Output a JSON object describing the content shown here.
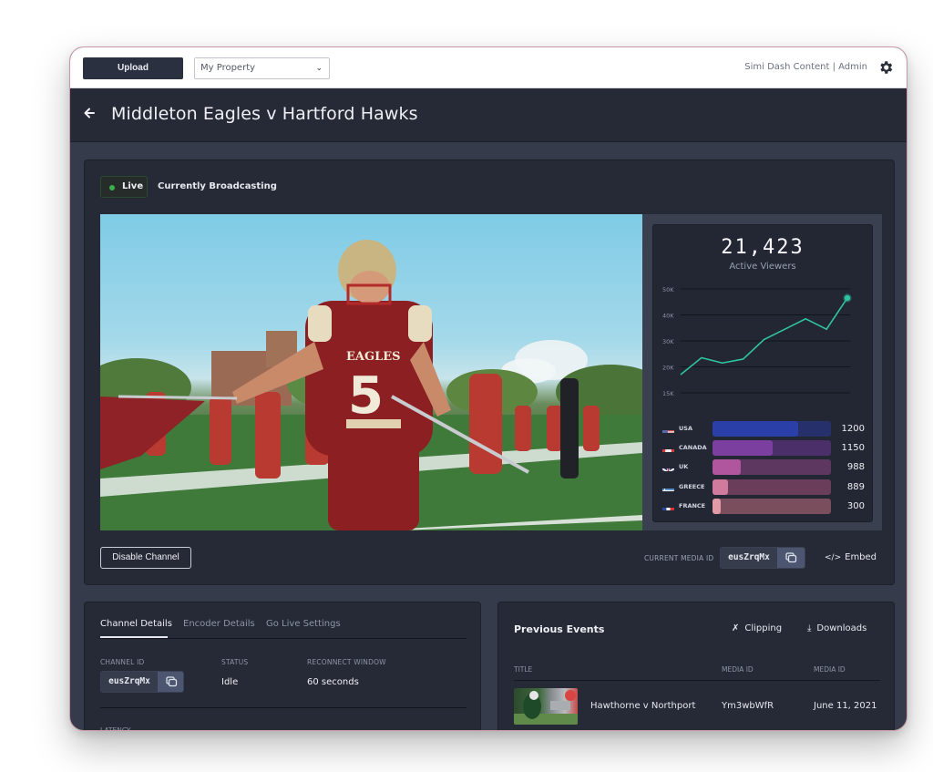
{
  "topbar": {
    "upload_label": "Upload",
    "property_select": {
      "value": "My Property"
    },
    "account_label": "Simi Dash Content | Admin",
    "settings_icon": "gear-icon"
  },
  "header": {
    "back_icon": "arrow-left-icon",
    "title": "Middleton Eagles v Hartford Hawks"
  },
  "broadcast": {
    "live_label": "Live",
    "status_text": "Currently Broadcasting",
    "live_color": "#3db04a"
  },
  "video": {
    "description": "Football player in red Eagles #5 jersey leading team onto field"
  },
  "stats": {
    "viewer_count": "21,423",
    "viewer_label": "Active Viewers",
    "line_color": "#2ec4a0",
    "countries": [
      {
        "flag": "us-flag-icon",
        "name": "USA",
        "value": "1200",
        "fill": 0.72,
        "color": "#2b3fa8",
        "track": "#26306a"
      },
      {
        "flag": "ca-flag-icon",
        "name": "CANADA",
        "value": "1150",
        "fill": 0.51,
        "color": "#7b3fa0",
        "track": "#4a2f68"
      },
      {
        "flag": "uk-flag-icon",
        "name": "UK",
        "value": "988",
        "fill": 0.24,
        "color": "#b0569e",
        "track": "#5e3760"
      },
      {
        "flag": "gr-flag-icon",
        "name": "GREECE",
        "value": "889",
        "fill": 0.13,
        "color": "#d07a9e",
        "track": "#6a3d5a"
      },
      {
        "flag": "fr-flag-icon",
        "name": "FRANCE",
        "value": "300",
        "fill": 0.07,
        "color": "#e29aa6",
        "track": "#7a4e5c"
      }
    ]
  },
  "chart_data": {
    "type": "line",
    "title": "Active Viewers",
    "ylabel": "",
    "xlabel": "",
    "y_ticks": [
      "50K",
      "40K",
      "30K",
      "20K",
      "15K"
    ],
    "y_tick_values": [
      50000,
      40000,
      30000,
      20000,
      15000
    ],
    "ylim": [
      15000,
      50000
    ],
    "grid": true,
    "x": [
      0,
      1,
      2,
      3,
      4,
      5,
      6,
      7,
      8
    ],
    "values": [
      18500,
      23500,
      21500,
      23000,
      30500,
      34500,
      38500,
      34500,
      46500
    ],
    "highlight_last_point": true
  },
  "controls": {
    "disable_label": "Disable Channel",
    "media_id_label": "CURRENT MEDIA ID",
    "media_id": "eusZrqMx",
    "copy_icon": "copy-icon",
    "embed_label": "Embed",
    "embed_icon": "code-icon"
  },
  "channel_details": {
    "tabs": [
      {
        "label": "Channel Details",
        "active": true
      },
      {
        "label": "Encoder Details",
        "active": false
      },
      {
        "label": "Go Live Settings",
        "active": false
      }
    ],
    "fields": {
      "channel_id_label": "CHANNEL ID",
      "channel_id": "eusZrqMx",
      "status_label": "STATUS",
      "status": "Idle",
      "reconnect_label": "RECONNECT WINDOW",
      "reconnect": "60 seconds",
      "latency_label": "LATENCY"
    }
  },
  "previous_events": {
    "title": "Previous Events",
    "clipping_label": "Clipping",
    "downloads_label": "Downloads",
    "columns": [
      "TITLE",
      "MEDIA ID",
      "MEDIA ID"
    ],
    "rows": [
      {
        "title": "Hawthorne v Northport",
        "media_id": "Ym3wbWfR",
        "date": "June 11, 2021"
      }
    ]
  }
}
